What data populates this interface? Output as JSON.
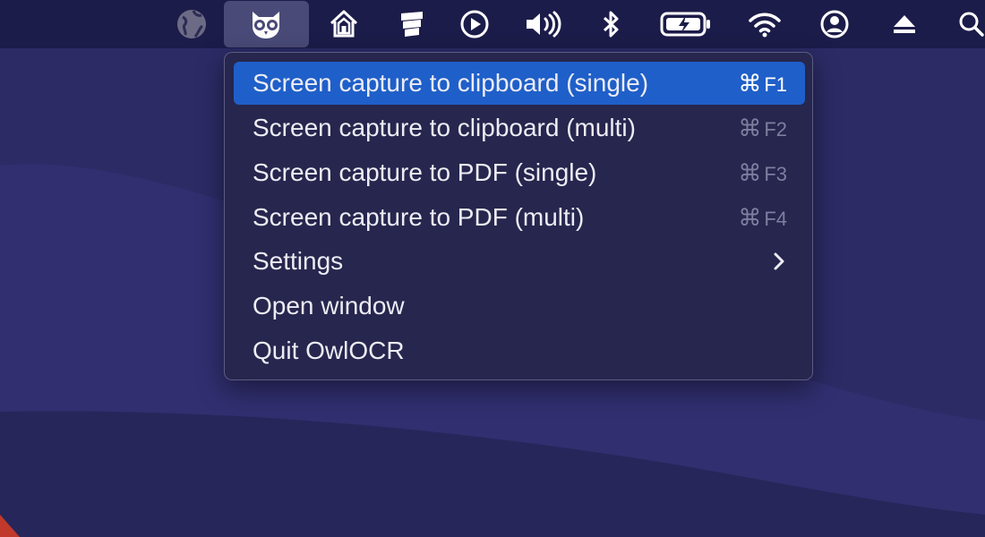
{
  "menubar": {
    "icons": [
      "globe-icon",
      "owl-icon",
      "home-icon",
      "stacks-icon",
      "play-icon",
      "volume-icon",
      "bluetooth-icon",
      "battery-charging-icon",
      "wifi-icon",
      "user-icon",
      "eject-icon",
      "search-icon"
    ]
  },
  "menu": {
    "items": [
      {
        "label": "Screen capture to clipboard (single)",
        "shortcut_mod": "⌘",
        "shortcut_key": "F1",
        "highlighted": true
      },
      {
        "label": "Screen capture to clipboard (multi)",
        "shortcut_mod": "⌘",
        "shortcut_key": "F2"
      },
      {
        "label": "Screen capture to PDF (single)",
        "shortcut_mod": "⌘",
        "shortcut_key": "F3"
      },
      {
        "label": "Screen capture to PDF (multi)",
        "shortcut_mod": "⌘",
        "shortcut_key": "F4"
      },
      {
        "label": "Settings",
        "submenu": true
      },
      {
        "label": "Open window"
      },
      {
        "label": "Quit OwlOCR"
      }
    ]
  },
  "colors": {
    "highlight": "#1f5fc9",
    "menu_bg": "#26264e",
    "menubar_bg": "#1c1c4a",
    "desktop": "#2b2a63"
  }
}
